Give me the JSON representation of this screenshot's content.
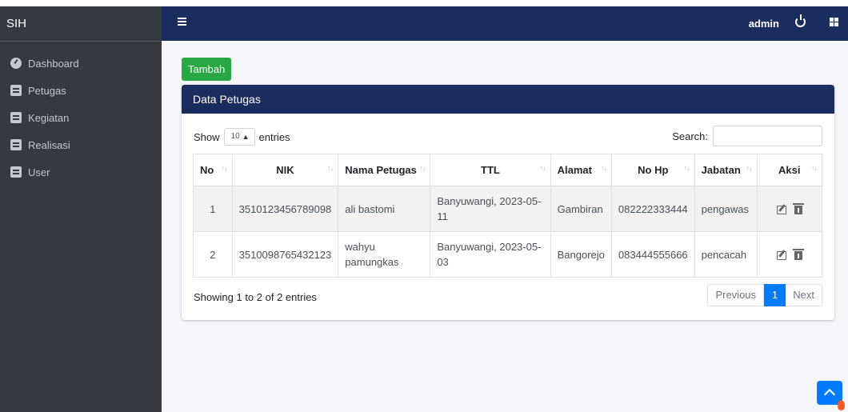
{
  "app": {
    "brand": "SIH"
  },
  "sidebar": {
    "items": [
      {
        "label": "Dashboard",
        "icon": "dashboard-icon"
      },
      {
        "label": "Petugas",
        "icon": "document-icon"
      },
      {
        "label": "Kegiatan",
        "icon": "document-icon"
      },
      {
        "label": "Realisasi",
        "icon": "document-icon"
      },
      {
        "label": "User",
        "icon": "document-icon"
      }
    ]
  },
  "topbar": {
    "user": "admin",
    "icons": [
      "menu-icon",
      "power-icon",
      "grid-icon"
    ]
  },
  "toolbar": {
    "add_label": "Tambah"
  },
  "card": {
    "title": "Data Petugas",
    "length": {
      "show": "Show",
      "value": "10",
      "entries": "entries"
    },
    "search": {
      "label": "Search:",
      "value": ""
    }
  },
  "table": {
    "headers": [
      "No",
      "NIK",
      "Nama Petugas",
      "TTL",
      "Alamat",
      "No Hp",
      "Jabatan",
      "Aksi"
    ],
    "rows": [
      {
        "no": "1",
        "nik": "3510123456789098",
        "nama": "ali bastomi",
        "ttl": "Banyuwangi, 2023-05-11",
        "alamat": "Gambiran",
        "hp": "082222333444",
        "jabatan": "pengawas"
      },
      {
        "no": "2",
        "nik": "3510098765432123",
        "nama": "wahyu pamungkas",
        "ttl": "Banyuwangi, 2023-05-03",
        "alamat": "Bangorejo",
        "hp": "083444555666",
        "jabatan": "pencacah"
      }
    ]
  },
  "footer": {
    "info": "Showing 1 to 2 of 2 entries",
    "pagination": {
      "previous": "Previous",
      "current": "1",
      "next": "Next"
    }
  },
  "colors": {
    "sidebar": "#343a40",
    "topbar": "#1b2d5e",
    "add_button": "#28a745",
    "accent": "#007bff"
  }
}
